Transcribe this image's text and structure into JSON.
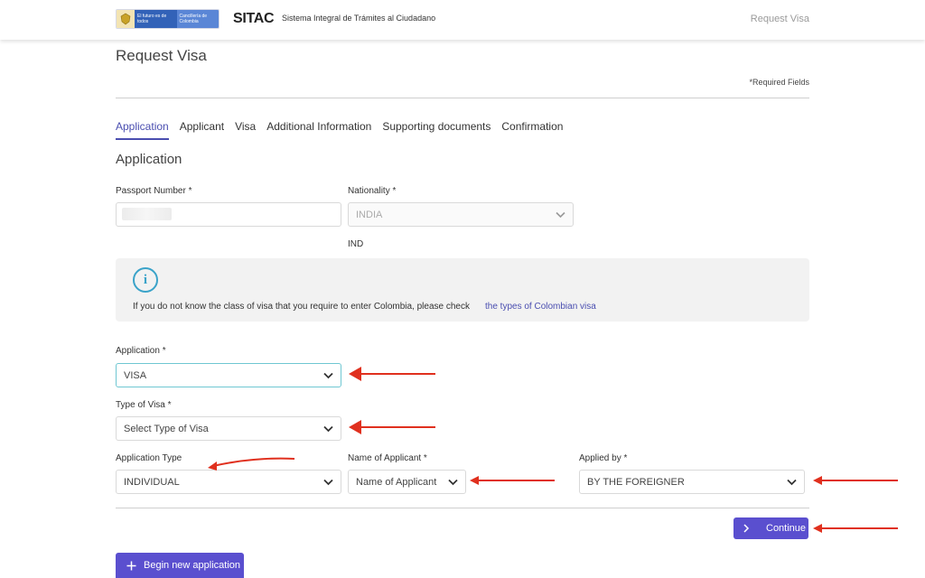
{
  "header": {
    "logo_text_1": "El futuro es de todos",
    "logo_text_2": "Cancillería de Colombia",
    "brand": "SITAC",
    "brand_sub": "Sistema Integral de Trámites al Ciudadano",
    "top_link": "Request Visa"
  },
  "page": {
    "title": "Request Visa",
    "required_note": "*Required Fields",
    "section_title": "Application"
  },
  "tabs": [
    {
      "label": "Application",
      "active": true
    },
    {
      "label": "Applicant"
    },
    {
      "label": "Visa"
    },
    {
      "label": "Additional Information"
    },
    {
      "label": "Supporting documents"
    },
    {
      "label": "Confirmation"
    }
  ],
  "form": {
    "passport_label": "Passport Number *",
    "nationality_label": "Nationality *",
    "nationality_value": "INDIA",
    "nationality_code": "IND",
    "application_label": "Application *",
    "application_value": "VISA",
    "visa_type_label": "Type of Visa *",
    "visa_type_value": "Select Type of Visa",
    "app_type_label": "Application Type",
    "app_type_value": "INDIVIDUAL",
    "applicant_name_label": "Name of Applicant *",
    "applicant_name_value": "Name of Applicant",
    "applied_by_label": "Applied by *",
    "applied_by_value": "BY THE FOREIGNER"
  },
  "info": {
    "text": "If you do not know the class of visa that you require to enter Colombia, please check",
    "link": "the types of Colombian visa"
  },
  "buttons": {
    "continue": "Continue",
    "begin_new": "Begin new application"
  },
  "colors": {
    "accent": "#4a4eb0",
    "button": "#5a4fcf",
    "annotation_arrow": "#e0301e"
  }
}
